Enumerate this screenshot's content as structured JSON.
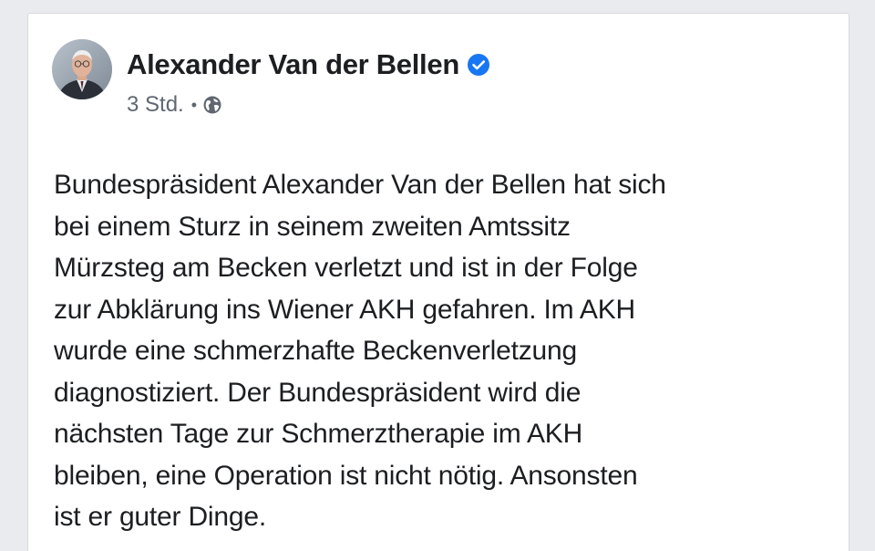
{
  "post": {
    "author": "Alexander Van der Bellen",
    "verified_icon": "verified-badge-icon",
    "timestamp": "3 Std.",
    "separator": "•",
    "audience_icon": "globe-icon",
    "body_lines": [
      "Bundespräsident Alexander Van der Bellen hat sich",
      "bei einem Sturz in seinem zweiten Amtssitz",
      "Mürzsteg am Becken verletzt und ist in der Folge",
      "zur Abklärung ins Wiener AKH gefahren. Im AKH",
      "wurde eine schmerzhafte Beckenverletzung",
      "diagnostiziert. Der Bundespräsident wird die",
      "nächsten Tage zur Schmerztherapie im AKH",
      "bleiben, eine Operation ist nicht nötig. Ansonsten",
      "ist er guter Dinge."
    ]
  },
  "colors": {
    "verified_blue": "#1877f2",
    "meta_gray": "#606770",
    "text": "#1c1e21"
  }
}
